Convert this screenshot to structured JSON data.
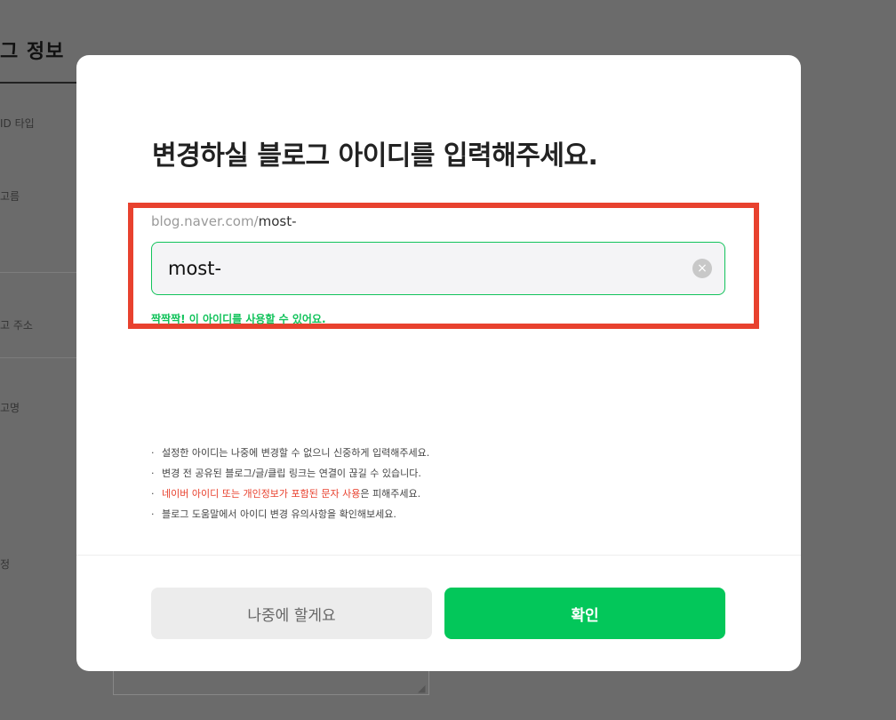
{
  "background": {
    "section_title": "그 정보",
    "labels": [
      "ID 타입",
      "고름",
      "고 주소",
      "고명",
      "정"
    ]
  },
  "modal": {
    "title": "변경하실 블로그 아이디를 입력해주세요.",
    "url_prefix": "blog.naver.com/",
    "url_value": "most-",
    "input_value": "most-",
    "clear_icon": "×",
    "success_message": "짝짝짝! 이 아이디를 사용할 수 있어요.",
    "notices": {
      "n1": "설정한 아이디는 나중에 변경할 수 없으니 신중하게 입력해주세요.",
      "n2": "변경 전 공유된 블로그/글/클립 링크는 연결이 끊길 수 있습니다.",
      "n3_warn": "네이버 아이디 또는 개인정보가 포함된 문자 사용",
      "n3_rest": "은 피해주세요.",
      "n4": "블로그 도움말에서 아이디 변경 유의사항을 확인해보세요."
    },
    "bullet": "·",
    "later_button": "나중에 할게요",
    "confirm_button": "확인"
  },
  "colors": {
    "brand_green": "#03c75a",
    "highlight_red": "#e8412e",
    "dim_background": "#6b6b6b"
  },
  "icons": {
    "clear": "clear-circle-icon"
  }
}
